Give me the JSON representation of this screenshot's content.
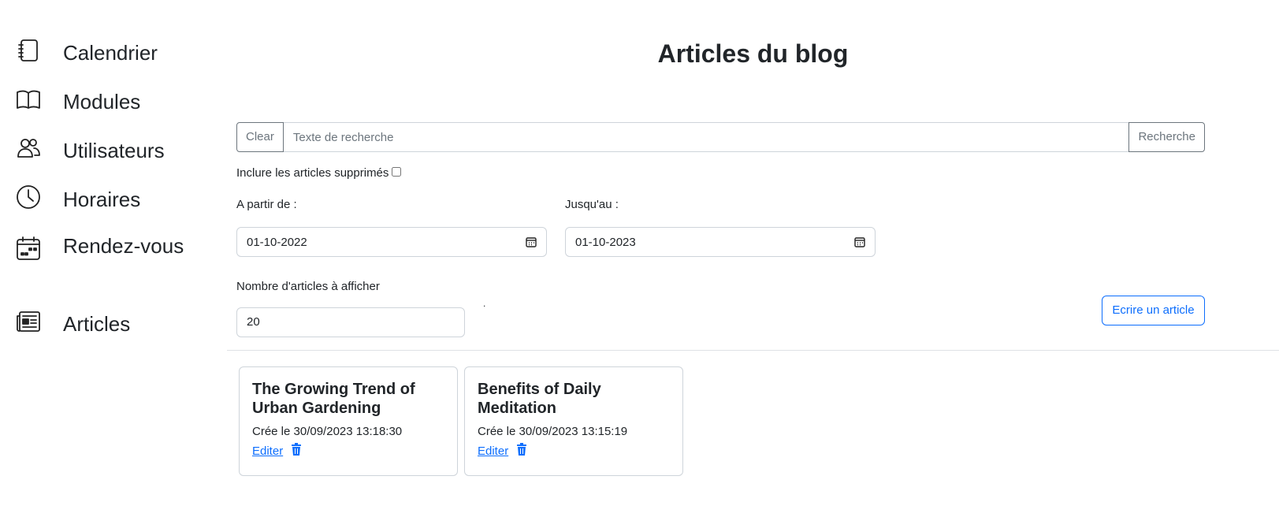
{
  "sidebar": {
    "items": [
      {
        "label": "Calendrier",
        "icon": "journal-icon"
      },
      {
        "label": "Modules",
        "icon": "book-icon"
      },
      {
        "label": "Utilisateurs",
        "icon": "people-icon"
      },
      {
        "label": "Horaires",
        "icon": "clock-icon"
      },
      {
        "label": "Rendez-vous",
        "icon": "calendar-week-icon"
      },
      {
        "label": "Articles",
        "icon": "newspaper-icon"
      }
    ]
  },
  "main": {
    "title": "Articles du blog",
    "search": {
      "clear_label": "Clear",
      "placeholder": "Texte de recherche",
      "search_label": "Recherche"
    },
    "include_deleted_label": "Inclure les articles supprimés",
    "include_deleted_checked": false,
    "from_label": "A partir de :",
    "from_value": "01-10-2022",
    "to_label": "Jusqu'au :",
    "to_value": "01-10-2023",
    "count_label": "Nombre d'articles à afficher",
    "count_value": "20",
    "dot": ".",
    "write_label": "Ecrire un article",
    "articles": [
      {
        "title": "The Growing Trend of Urban Gardening",
        "created": "Crée le 30/09/2023 13:18:30",
        "edit_label": "Editer"
      },
      {
        "title": "Benefits of Daily Meditation",
        "created": "Crée le 30/09/2023 13:15:19",
        "edit_label": "Editer"
      }
    ]
  },
  "colors": {
    "accent": "#0d6efd",
    "border": "#ced4da",
    "secondary": "#6c757d"
  }
}
